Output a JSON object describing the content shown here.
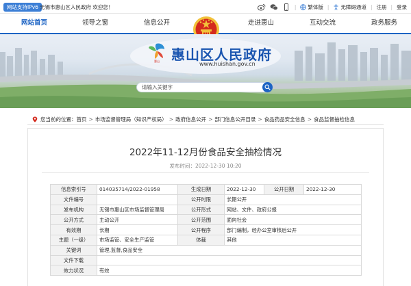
{
  "topbar": {
    "ipv6_badge": "网站支持IPv6",
    "welcome": "无锡市惠山区人民政府 欢迎您！",
    "links": {
      "traditional": "繁体版",
      "accessibility": "无障碍通道",
      "register": "注册",
      "login": "登录"
    }
  },
  "nav": {
    "items": [
      "网站首页",
      "领导之窗",
      "信息公开",
      "走进惠山",
      "互动交流",
      "政务服务"
    ]
  },
  "banner": {
    "site_title": "惠山区人民政府",
    "site_url": "www.huishan.gov.cn",
    "logo_text": "惠山",
    "search_placeholder": "请输入关键字"
  },
  "breadcrumb": {
    "prefix": "您当前的位置：",
    "items": [
      "首页",
      "市场监督管理局（知识产权局）",
      "政府信息公开",
      "部门信息公开目录",
      "食品药品安全信息",
      "食品监督抽检信息"
    ]
  },
  "article": {
    "title": "2022年11-12月份食品安全抽检情况",
    "publish_label": "发布时间：2022-12-30 10:20"
  },
  "info_table": {
    "rows": [
      [
        {
          "k": "信息索引号"
        },
        {
          "v": "014035714/2022-01958"
        },
        {
          "k": "生成日期"
        },
        {
          "v": "2022-12-30"
        },
        {
          "k": "公开日期"
        },
        {
          "v": "2022-12-30"
        }
      ],
      [
        {
          "k": "文件编号"
        },
        {
          "v": ""
        },
        {
          "k": "公开时限"
        },
        {
          "v": "长期公开"
        }
      ],
      [
        {
          "k": "发布机构"
        },
        {
          "v": "无锡市惠山区市场监督管理局"
        },
        {
          "k": "公开形式"
        },
        {
          "v": "网站、文件、政府公报"
        }
      ],
      [
        {
          "k": "公开方式"
        },
        {
          "v": "主动公开"
        },
        {
          "k": "公开范围"
        },
        {
          "v": "面向社会"
        }
      ],
      [
        {
          "k": "有效期"
        },
        {
          "v": "长期"
        },
        {
          "k": "公开程序"
        },
        {
          "v": "部门编制，经办公室审核后公开"
        }
      ],
      [
        {
          "k": "主题（一级）"
        },
        {
          "v": "市场监管、安全生产监管"
        },
        {
          "k": "体裁"
        },
        {
          "v": "其他"
        }
      ],
      [
        {
          "k": "关键词"
        },
        {
          "v": "管理,监督,食品安全"
        }
      ],
      [
        {
          "k": "文件下载"
        },
        {
          "v": ""
        }
      ],
      [
        {
          "k": "效力状况"
        },
        {
          "v": "有效"
        }
      ]
    ]
  },
  "colors": {
    "brand_blue": "#1d64c4",
    "emblem_red": "#d42a1e",
    "emblem_gold": "#f2c23a"
  }
}
